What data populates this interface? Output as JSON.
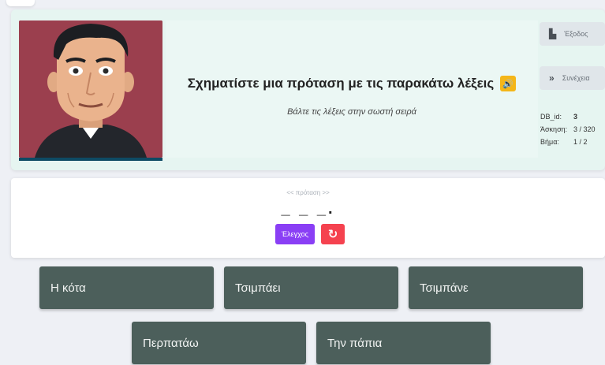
{
  "header": {
    "title": "Σχηματίστε μια πρόταση με τις παρακάτω λέξεις",
    "subtitle": "Βάλτε τις λέξεις στην σωστή σειρά",
    "sound_icon": "speaker-icon"
  },
  "side": {
    "exit_label": "Έξοδος",
    "exit_icon": "door-icon",
    "next_label": "Συνέχεια",
    "next_icon": "double-chevron-right-icon"
  },
  "meta": {
    "db_id_label": "DB_id:",
    "db_id_value": "3",
    "exercise_label": "Άσκηση:",
    "exercise_value": "3 / 320",
    "step_label": "Βήμα:",
    "step_value": "1 / 2"
  },
  "answer": {
    "hint": "<< πρόταση >>",
    "blanks": "_ _ _.",
    "check_label": "Έλεγχος",
    "reset_icon": "refresh-icon"
  },
  "words": [
    "Η κότα",
    "Τσιμπάει",
    "Τσιμπάνε",
    "Περπατάω",
    "Την πάπια"
  ],
  "colors": {
    "header_bg": "#e6f5f1",
    "tile_bg": "#4c5f5b",
    "check_btn": "#8a3ff5",
    "reset_btn": "#f5424f",
    "sound_btn": "#f4b619"
  }
}
